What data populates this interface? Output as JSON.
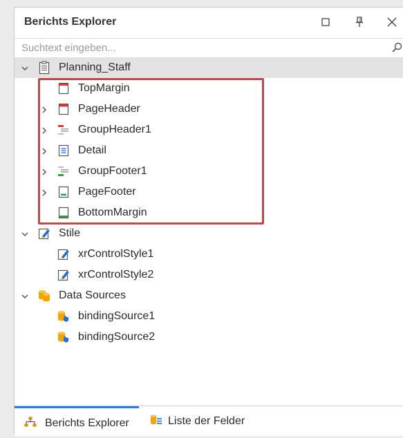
{
  "panel": {
    "title": "Berichts Explorer",
    "buttons": [
      {
        "name": "maximize",
        "icon": "maximize-icon"
      },
      {
        "name": "pin",
        "icon": "pin-icon"
      },
      {
        "name": "close",
        "icon": "close-icon"
      }
    ]
  },
  "search": {
    "placeholder": "Suchtext eingeben...",
    "value": "",
    "icon": "search-icon"
  },
  "tree": {
    "root": {
      "label": "Planning_Staff",
      "icon": "report-icon",
      "expanded": true,
      "selected": true
    },
    "bands": [
      {
        "label": "TopMargin",
        "icon": "top-margin-band-icon",
        "expandable": false
      },
      {
        "label": "PageHeader",
        "icon": "page-header-band-icon",
        "expandable": true
      },
      {
        "label": "GroupHeader1",
        "icon": "group-header-band-icon",
        "expandable": true
      },
      {
        "label": "Detail",
        "icon": "detail-band-icon",
        "expandable": true
      },
      {
        "label": "GroupFooter1",
        "icon": "group-footer-band-icon",
        "expandable": true
      },
      {
        "label": "PageFooter",
        "icon": "page-footer-band-icon",
        "expandable": true
      },
      {
        "label": "BottomMargin",
        "icon": "bottom-margin-band-icon",
        "expandable": false
      }
    ],
    "styles": {
      "label": "Stile",
      "icon": "styles-icon",
      "expanded": true,
      "items": [
        {
          "label": "xrControlStyle1",
          "icon": "control-style-icon"
        },
        {
          "label": "xrControlStyle2",
          "icon": "control-style-icon"
        }
      ]
    },
    "data_sources": {
      "label": "Data Sources",
      "icon": "database-icon",
      "expanded": true,
      "items": [
        {
          "label": "bindingSource1",
          "icon": "binding-source-icon"
        },
        {
          "label": "bindingSource2",
          "icon": "binding-source-icon"
        }
      ]
    }
  },
  "tabs": [
    {
      "label": "Berichts Explorer",
      "icon": "tree-structure-icon",
      "active": true
    },
    {
      "label": "Liste der Felder",
      "icon": "field-list-icon",
      "active": false
    }
  ],
  "colors": {
    "accent": "#2c7cd6",
    "highlight_border": "#b84a50",
    "band_header_red": "#d9363e",
    "band_footer_green": "#2e9e4f",
    "selected_row": "#e3e3e3",
    "style_icon_blue": "#2a6fd0",
    "database_orange": "#f0a500"
  }
}
